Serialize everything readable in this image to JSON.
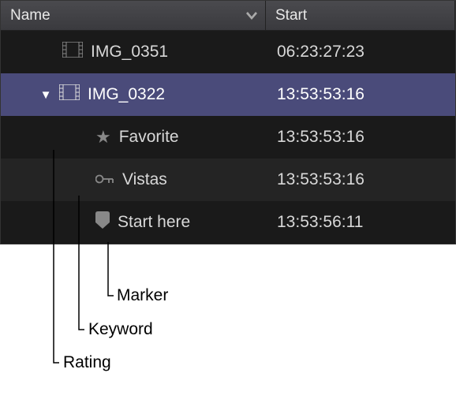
{
  "columns": {
    "name": "Name",
    "start": "Start"
  },
  "rows": [
    {
      "name": "IMG_0351",
      "start": "06:23:27:23"
    },
    {
      "name": "IMG_0322",
      "start": "13:53:53:16"
    },
    {
      "name": "Favorite",
      "start": "13:53:53:16"
    },
    {
      "name": "Vistas",
      "start": "13:53:53:16"
    },
    {
      "name": "Start here",
      "start": "13:53:56:11"
    }
  ],
  "annotations": {
    "marker": "Marker",
    "keyword": "Keyword",
    "rating": "Rating"
  }
}
